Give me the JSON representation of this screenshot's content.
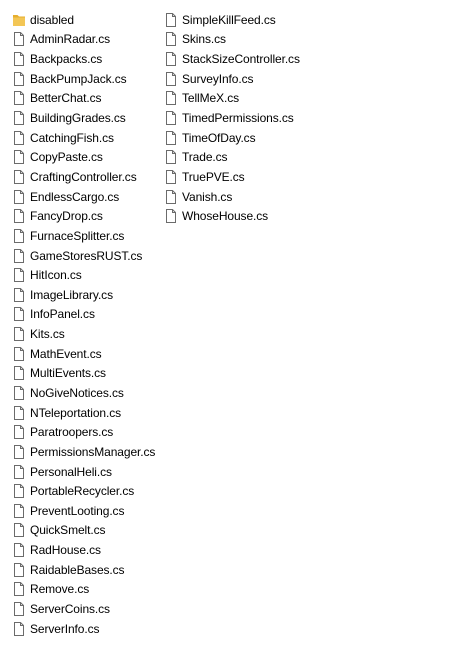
{
  "colors": {
    "folder": "#f3c655",
    "folder_shade": "#e6ae2e",
    "file_outline": "#6b6b6b",
    "text": "#000000",
    "background": "#ffffff"
  },
  "file_list": {
    "left_column": [
      {
        "label": "disabled",
        "icon": "folder-icon",
        "type": "folder"
      },
      {
        "label": "AdminRadar.cs",
        "icon": "file-icon",
        "type": "file"
      },
      {
        "label": "Backpacks.cs",
        "icon": "file-icon",
        "type": "file"
      },
      {
        "label": "BackPumpJack.cs",
        "icon": "file-icon",
        "type": "file"
      },
      {
        "label": "BetterChat.cs",
        "icon": "file-icon",
        "type": "file"
      },
      {
        "label": "BuildingGrades.cs",
        "icon": "file-icon",
        "type": "file"
      },
      {
        "label": "CatchingFish.cs",
        "icon": "file-icon",
        "type": "file"
      },
      {
        "label": "CopyPaste.cs",
        "icon": "file-icon",
        "type": "file"
      },
      {
        "label": "CraftingController.cs",
        "icon": "file-icon",
        "type": "file"
      },
      {
        "label": "EndlessCargo.cs",
        "icon": "file-icon",
        "type": "file"
      },
      {
        "label": "FancyDrop.cs",
        "icon": "file-icon",
        "type": "file"
      },
      {
        "label": "FurnaceSplitter.cs",
        "icon": "file-icon",
        "type": "file"
      },
      {
        "label": "GameStoresRUST.cs",
        "icon": "file-icon",
        "type": "file"
      },
      {
        "label": "HitIcon.cs",
        "icon": "file-icon",
        "type": "file"
      },
      {
        "label": "ImageLibrary.cs",
        "icon": "file-icon",
        "type": "file"
      },
      {
        "label": "InfoPanel.cs",
        "icon": "file-icon",
        "type": "file"
      },
      {
        "label": "Kits.cs",
        "icon": "file-icon",
        "type": "file"
      },
      {
        "label": "MathEvent.cs",
        "icon": "file-icon",
        "type": "file"
      },
      {
        "label": "MultiEvents.cs",
        "icon": "file-icon",
        "type": "file"
      },
      {
        "label": "NoGiveNotices.cs",
        "icon": "file-icon",
        "type": "file"
      },
      {
        "label": "NTeleportation.cs",
        "icon": "file-icon",
        "type": "file"
      },
      {
        "label": "Paratroopers.cs",
        "icon": "file-icon",
        "type": "file"
      },
      {
        "label": "PermissionsManager.cs",
        "icon": "file-icon",
        "type": "file"
      },
      {
        "label": "PersonalHeli.cs",
        "icon": "file-icon",
        "type": "file"
      },
      {
        "label": "PortableRecycler.cs",
        "icon": "file-icon",
        "type": "file"
      },
      {
        "label": "PreventLooting.cs",
        "icon": "file-icon",
        "type": "file"
      },
      {
        "label": "QuickSmelt.cs",
        "icon": "file-icon",
        "type": "file"
      },
      {
        "label": "RadHouse.cs",
        "icon": "file-icon",
        "type": "file"
      },
      {
        "label": "RaidableBases.cs",
        "icon": "file-icon",
        "type": "file"
      },
      {
        "label": "Remove.cs",
        "icon": "file-icon",
        "type": "file"
      },
      {
        "label": "ServerCoins.cs",
        "icon": "file-icon",
        "type": "file"
      },
      {
        "label": "ServerInfo.cs",
        "icon": "file-icon",
        "type": "file"
      }
    ],
    "right_column": [
      {
        "label": "SimpleKillFeed.cs",
        "icon": "file-icon",
        "type": "file"
      },
      {
        "label": "Skins.cs",
        "icon": "file-icon",
        "type": "file"
      },
      {
        "label": "StackSizeController.cs",
        "icon": "file-icon",
        "type": "file"
      },
      {
        "label": "SurveyInfo.cs",
        "icon": "file-icon",
        "type": "file"
      },
      {
        "label": "TellMeX.cs",
        "icon": "file-icon",
        "type": "file"
      },
      {
        "label": "TimedPermissions.cs",
        "icon": "file-icon",
        "type": "file"
      },
      {
        "label": "TimeOfDay.cs",
        "icon": "file-icon",
        "type": "file"
      },
      {
        "label": "Trade.cs",
        "icon": "file-icon",
        "type": "file"
      },
      {
        "label": "TruePVE.cs",
        "icon": "file-icon",
        "type": "file"
      },
      {
        "label": "Vanish.cs",
        "icon": "file-icon",
        "type": "file"
      },
      {
        "label": "WhoseHouse.cs",
        "icon": "file-icon",
        "type": "file"
      }
    ]
  }
}
